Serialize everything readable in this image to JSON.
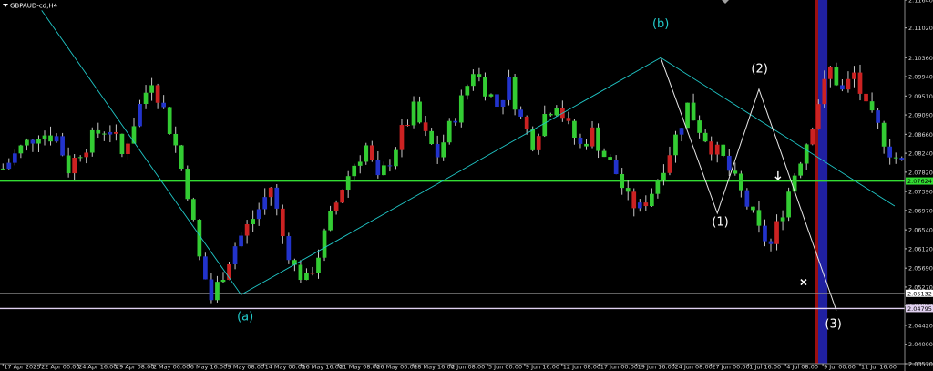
{
  "window": {
    "symbol_title": "GBPAUD-cd,H4"
  },
  "colors": {
    "background": "#000000",
    "bull_body": "#33cc33",
    "bear_body": "#cc2222",
    "alt_body": "#2233cc",
    "wick": "#c8c8c8",
    "trend_line": "#20c8c8",
    "wave_line": "#e8e8e8",
    "support_line": "#33dd33",
    "lower_line": "#e0d0f0",
    "label_cyan": "#22cccc",
    "label_white": "#ffffff",
    "band_red": "#9a1010",
    "band_blue": "#2020a0"
  },
  "chart_data": {
    "type": "candlestick",
    "symbol": "GBPAUD-cd",
    "timeframe": "H4",
    "ylim": [
      2.0357,
      2.1164
    ],
    "y_ticks": [
      "2.11640",
      "2.11020",
      "2.10360",
      "2.09940",
      "2.09510",
      "2.09090",
      "2.08660",
      "2.08240",
      "2.07820",
      "2.07390",
      "2.06970",
      "2.06540",
      "2.06120",
      "2.05690",
      "2.05270",
      "2.04850",
      "2.04420",
      "2.04000",
      "2.03570"
    ],
    "x_ticks": [
      "17 Apr 2025",
      "22 Apr 00:00",
      "24 Apr 16:00",
      "29 Apr 08:00",
      "2 May 00:00",
      "6 May 16:00",
      "9 May 08:00",
      "14 May 00:00",
      "16 May 16:00",
      "21 May 08:00",
      "26 May 00:00",
      "28 May 16:00",
      "2 Jun 08:00",
      "5 Jun 00:00",
      "9 Jun 16:00",
      "12 Jun 08:00",
      "17 Jun 00:00",
      "19 Jun 16:00",
      "24 Jun 08:00",
      "27 Jun 00:00",
      "1 Jul 16:00",
      "4 Jul 08:00",
      "9 Jul 00:00",
      "11 Jul 16:00"
    ],
    "price_levels": [
      {
        "value": 2.07624,
        "label": "2.07624",
        "box_color": "#33dd33",
        "text_color": "#000000"
      },
      {
        "value": 2.05132,
        "label": "2.05132",
        "box_color": "#ffffff",
        "text_color": "#000000"
      },
      {
        "value": 2.04795,
        "label": "2.04795",
        "box_color": "#e0d0f0",
        "text_color": "#000000"
      }
    ],
    "wave_labels": [
      {
        "text": "(a)",
        "bar": 40.7,
        "price": 2.0453,
        "color": "#22cccc"
      },
      {
        "text": "(b)",
        "bar": 110.5,
        "price": 2.1103,
        "color": "#22cccc"
      },
      {
        "text": "(1)",
        "bar": 120.5,
        "price": 2.0663,
        "color": "#ffffff"
      },
      {
        "text": "(2)",
        "bar": 127.1,
        "price": 2.1003,
        "color": "#ffffff"
      },
      {
        "text": "(3)",
        "bar": 139.5,
        "price": 2.0437,
        "color": "#ffffff"
      }
    ],
    "trend_lines": [
      {
        "from": [
          6.5,
          2.1141
        ],
        "to": [
          40,
          2.051
        ]
      },
      {
        "from": [
          40,
          2.051
        ],
        "to": [
          110.5,
          2.1036
        ]
      },
      {
        "from": [
          110.5,
          2.1036
        ],
        "to": [
          149.8,
          2.0707
        ]
      }
    ],
    "wave_path": [
      [
        110.5,
        2.1036
      ],
      [
        120,
        2.0691
      ],
      [
        127,
        2.0966
      ],
      [
        140,
        2.0475
      ]
    ],
    "vertical_bands_at_bar": [
      137,
      138
    ],
    "ohlc": []
  }
}
